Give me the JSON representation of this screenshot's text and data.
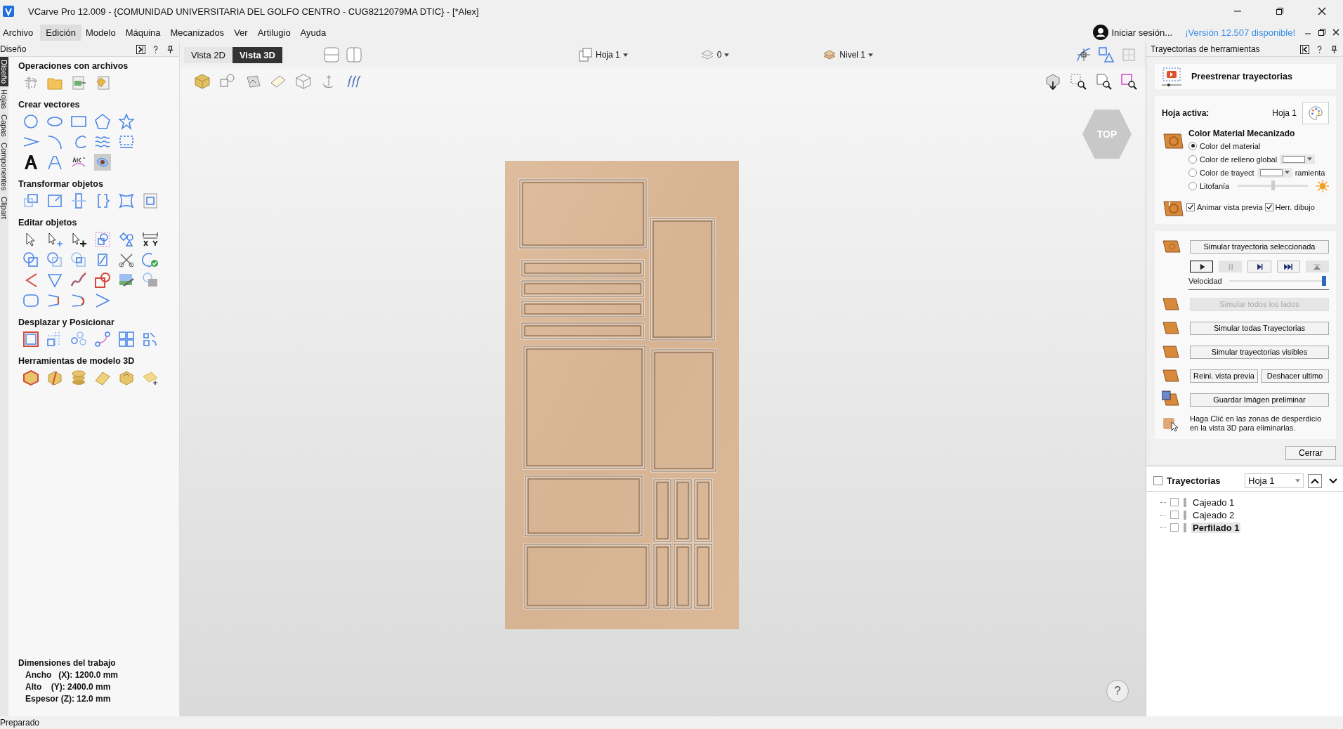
{
  "window": {
    "title": "VCarve Pro 12.009 - {COMUNIDAD UNIVERSITARIA DEL GOLFO CENTRO - CUG8212079MA DTIC} - [*Alex]"
  },
  "menu": [
    {
      "label": "Archivo",
      "selected": false
    },
    {
      "label": "Edición",
      "selected": true
    },
    {
      "label": "Modelo",
      "selected": false
    },
    {
      "label": "Máquina",
      "selected": false
    },
    {
      "label": "Mecanizados",
      "selected": false
    },
    {
      "label": "Ver",
      "selected": false
    },
    {
      "label": "Artilugio",
      "selected": false
    },
    {
      "label": "Ayuda",
      "selected": false
    }
  ],
  "account": {
    "label": "Iniciar sesión...",
    "update_link": "¡Versión 12.507 disponible!"
  },
  "left_panel": {
    "title": "Diseño",
    "side_tabs": [
      {
        "label": "Diseño",
        "selected": true
      },
      {
        "label": "Hojas",
        "selected": false
      },
      {
        "label": "Capas",
        "selected": false
      },
      {
        "label": "Componentes",
        "selected": false
      },
      {
        "label": "Clipart",
        "selected": false
      }
    ],
    "sections": [
      {
        "title": "Operaciones con archivos"
      },
      {
        "title": "Crear vectores"
      },
      {
        "title": "Transformar objetos"
      },
      {
        "title": "Editar objetos"
      },
      {
        "title": "Desplazar y Posicionar"
      },
      {
        "title": "Herramientas de modelo 3D"
      }
    ],
    "job_dimensions": {
      "title": "Dimensiones del trabajo",
      "lines": [
        "Ancho   (X): 1200.0 mm",
        "Alto    (Y): 2400.0 mm",
        "Espesor (Z): 12.0 mm"
      ]
    }
  },
  "view_tabs": [
    {
      "label": "Vista 2D",
      "selected": false
    },
    {
      "label": "Vista 3D",
      "selected": true
    }
  ],
  "selectors": {
    "sheet": "Hoja 1",
    "count": "0",
    "level": "Nivel 1"
  },
  "view_cube": "TOP",
  "help": "?",
  "right_panel": {
    "title": "Trayectorias de herramientas",
    "header": "Preestrenar trayectorias",
    "active_sheet_label": "Hoja activa:",
    "active_sheet": "Hoja 1",
    "material_title": "Color Material Mecanizado",
    "color_options": [
      {
        "label": "Color del material",
        "selected": true,
        "kind": "plain"
      },
      {
        "label": "Color de relleno global",
        "selected": false,
        "kind": "swatch"
      },
      {
        "label": "Color de trayect",
        "tail": "ramienta",
        "selected": false,
        "kind": "swatch"
      },
      {
        "label": "Litofanía",
        "selected": false,
        "kind": "slider",
        "level": 0.5
      }
    ],
    "checkboxes": [
      {
        "label": "Animar vista previa",
        "checked": true
      },
      {
        "label": "Herr. dibujo",
        "checked": true
      }
    ],
    "simulate_selected": "Simular trayectoria seleccionada",
    "playback": [
      {
        "kind": "play",
        "disabled": false
      },
      {
        "kind": "pause",
        "disabled": true
      },
      {
        "kind": "step",
        "disabled": false
      },
      {
        "kind": "end",
        "disabled": false
      },
      {
        "kind": "top",
        "disabled": true
      }
    ],
    "speed": {
      "label": "Velocidad",
      "level": 1.0
    },
    "action_rows": [
      [
        {
          "label": "Simular todos los lados",
          "disabled": true
        }
      ],
      [
        {
          "label": "Simular todas Trayectorias",
          "disabled": false
        }
      ],
      [
        {
          "label": "Simular trayectorias visibles",
          "disabled": false
        }
      ],
      [
        {
          "label": "Reini. vista previa",
          "disabled": false
        },
        {
          "label": "Deshacer ultimo",
          "disabled": false
        }
      ],
      [
        {
          "label": "Guardar Imágen preliminar",
          "disabled": false
        }
      ]
    ],
    "hint": "Haga Clić en las zonas de desperdicio en la vista 3D para eliminarlas.",
    "close": "Cerrar"
  },
  "toolpaths": {
    "title": "Trayectorias",
    "checked": false,
    "sheet": "Hoja 1",
    "items": [
      {
        "name": "Cajeado 1",
        "checked": false,
        "selected": false
      },
      {
        "name": "Cajeado 2",
        "checked": false,
        "selected": false
      },
      {
        "name": "Perfilado 1",
        "checked": false,
        "selected": true
      }
    ]
  },
  "status_bar": "Preparado"
}
